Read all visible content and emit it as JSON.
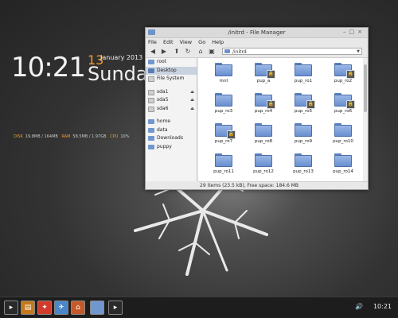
{
  "clock": {
    "time": "10:21",
    "day": "13",
    "month_year": "January 2013",
    "weekday": "Sunday",
    "stats": [
      {
        "label": "DISK",
        "value": "19.8MB / 164MB"
      },
      {
        "label": "RAM",
        "value": "58.5MB / 1.97GB"
      },
      {
        "label": "CPU",
        "value": "10%"
      }
    ]
  },
  "window": {
    "title": "/initrd - File Manager",
    "menu": [
      "File",
      "Edit",
      "View",
      "Go",
      "Help"
    ],
    "address": "/initrd",
    "sidebar": [
      {
        "label": "root",
        "icon": "folder-icon"
      },
      {
        "label": "Desktop",
        "icon": "desktop-icon",
        "selected": true
      },
      {
        "label": "File System",
        "icon": "drive-icon"
      },
      {
        "label": "sda1",
        "icon": "drive-icon",
        "eject": true
      },
      {
        "label": "sda5",
        "icon": "drive-icon",
        "eject": true
      },
      {
        "label": "sda6",
        "icon": "drive-icon",
        "eject": true
      },
      {
        "label": "home",
        "icon": "folder-icon"
      },
      {
        "label": "data",
        "icon": "folder-icon"
      },
      {
        "label": "Downloads",
        "icon": "folder-icon"
      },
      {
        "label": "puppy",
        "icon": "folder-icon"
      }
    ],
    "files": [
      {
        "name": "mnt",
        "locked": false
      },
      {
        "name": "pup_a",
        "locked": true
      },
      {
        "name": "pup_ro1",
        "locked": false
      },
      {
        "name": "pup_ro2",
        "locked": true
      },
      {
        "name": "pup_ro3",
        "locked": false
      },
      {
        "name": "pup_ro4",
        "locked": true
      },
      {
        "name": "pup_ro5",
        "locked": true
      },
      {
        "name": "pup_ro6",
        "locked": true
      },
      {
        "name": "pup_ro7",
        "locked": true
      },
      {
        "name": "pup_ro8",
        "locked": false
      },
      {
        "name": "pup_ro9",
        "locked": false
      },
      {
        "name": "pup_ro10",
        "locked": false
      },
      {
        "name": "pup_ro11",
        "locked": false
      },
      {
        "name": "pup_ro12",
        "locked": false
      },
      {
        "name": "pup_ro13",
        "locked": false
      },
      {
        "name": "pup_ro14",
        "locked": false
      }
    ],
    "status": "29 items (23.5 kB), Free space: 184.6 MB"
  },
  "taskbar": {
    "launchers": [
      {
        "name": "terminal-launcher-icon",
        "color": "#2a2a2a"
      },
      {
        "name": "system-monitor-icon",
        "color": "#c47a1c"
      },
      {
        "name": "apps-menu-icon",
        "color": "#d23b2c"
      },
      {
        "name": "package-manager-icon",
        "color": "#4a86c8"
      },
      {
        "name": "web-browser-icon",
        "color": "#c45a2a"
      }
    ],
    "tasks": [
      {
        "name": "file-manager-task-icon",
        "color": "#7197cf"
      },
      {
        "name": "terminal-task-icon",
        "color": "#2a2a2a"
      }
    ],
    "volume_icon": "volume-icon",
    "time": "10:21"
  },
  "colors": {
    "accent": "#f39c2b",
    "folder": "#6f93c9",
    "taskbar": "#1d1d1d"
  }
}
